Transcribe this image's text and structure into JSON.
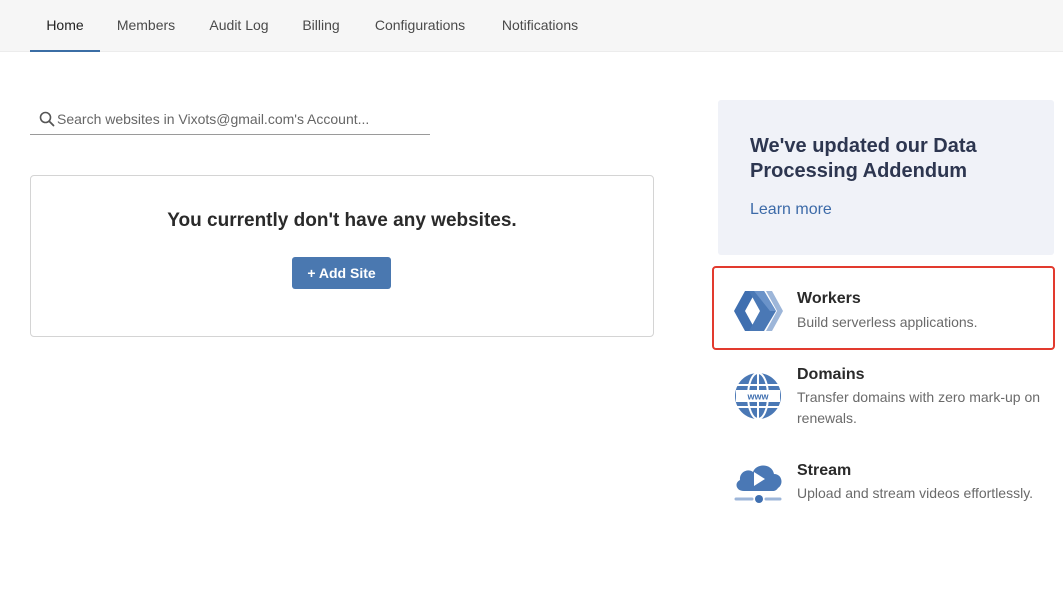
{
  "nav": {
    "tabs": [
      {
        "label": "Home",
        "active": true
      },
      {
        "label": "Members"
      },
      {
        "label": "Audit Log"
      },
      {
        "label": "Billing"
      },
      {
        "label": "Configurations"
      },
      {
        "label": "Notifications"
      }
    ]
  },
  "search": {
    "placeholder": "Search websites in Vixots@gmail.com's Account...",
    "icon": "search-icon"
  },
  "websites": {
    "empty_message": "You currently don't have any websites.",
    "add_site_label": "+ Add Site"
  },
  "promo": {
    "title": "We've updated our Data Processing Addendum",
    "link_label": "Learn more"
  },
  "products": [
    {
      "title": "Workers",
      "description": "Build serverless applications.",
      "icon": "workers-icon",
      "highlighted": true
    },
    {
      "title": "Domains",
      "description": "Transfer domains with zero mark-up on renewals.",
      "icon": "domains-globe-icon"
    },
    {
      "title": "Stream",
      "description": "Upload and stream videos effortlessly.",
      "icon": "stream-cloud-icon"
    }
  ],
  "colors": {
    "accent": "#4a78b0",
    "link": "#3c6aa8",
    "highlight_border": "#e23a2e",
    "promo_bg": "#f0f2f8"
  }
}
